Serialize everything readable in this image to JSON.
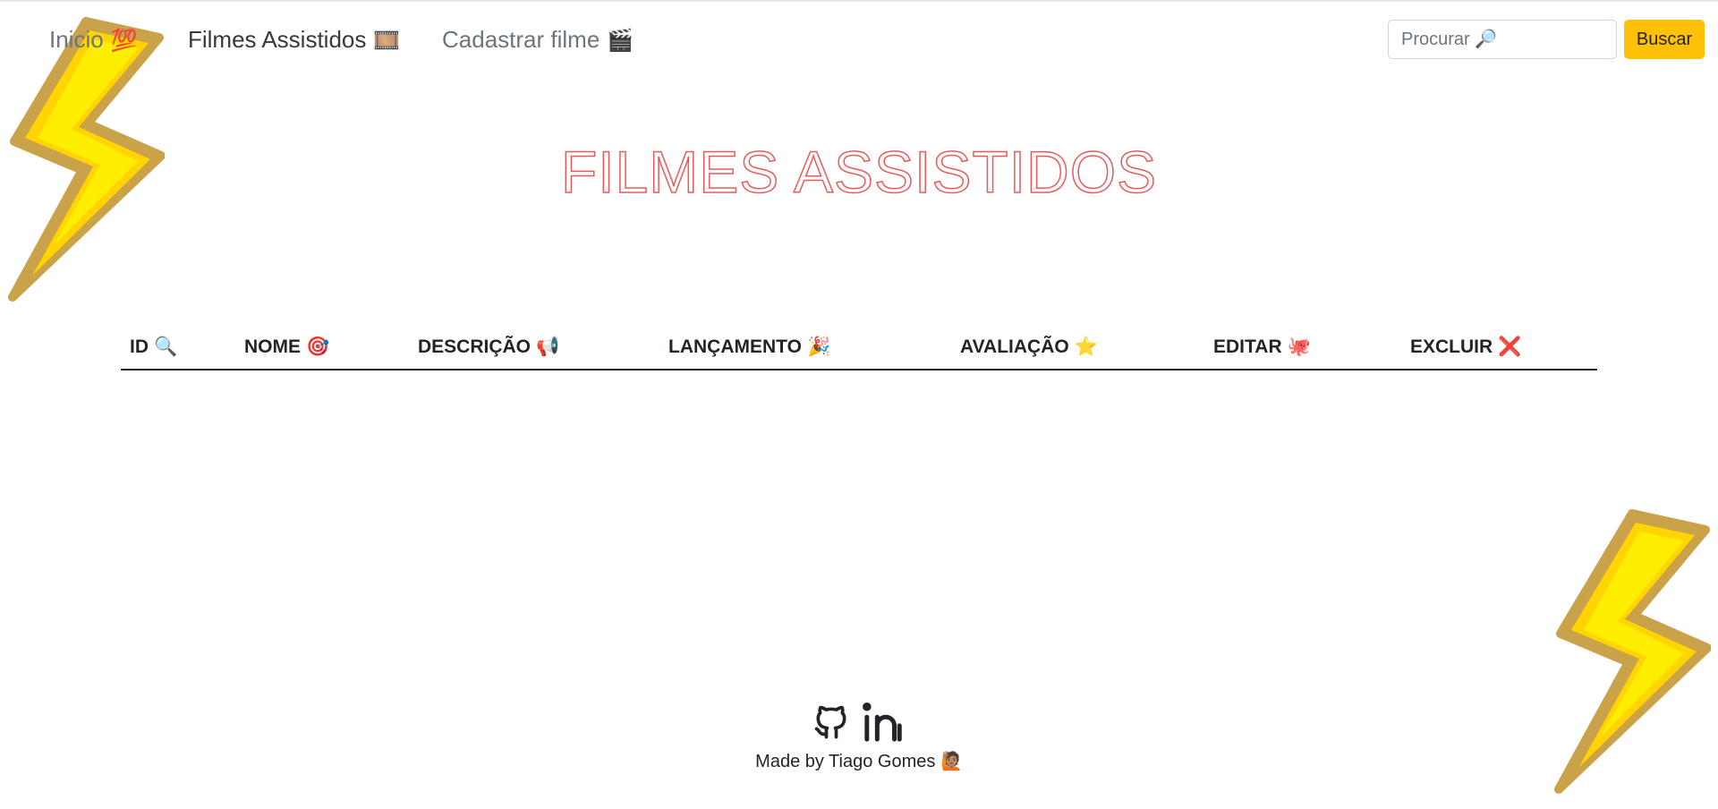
{
  "nav": {
    "items": [
      {
        "label": "Inicio",
        "emoji": "💯"
      },
      {
        "label": "Filmes Assistidos",
        "emoji": "🎞️"
      },
      {
        "label": "Cadastrar filme",
        "emoji": "🎬"
      }
    ],
    "search_placeholder": "Procurar 🔎",
    "search_button": "Buscar"
  },
  "page": {
    "title": "FILMES ASSISTIDOS"
  },
  "table": {
    "columns": [
      {
        "label": "ID",
        "emoji": "🔍"
      },
      {
        "label": "NOME",
        "emoji": "🎯"
      },
      {
        "label": "DESCRIÇÃO",
        "emoji": "📢"
      },
      {
        "label": "LANÇAMENTO",
        "emoji": "🎉"
      },
      {
        "label": "AVALIAÇÃO",
        "emoji": "⭐"
      },
      {
        "label": "EDITAR",
        "emoji": "🐙"
      },
      {
        "label": "EXCLUIR",
        "emoji": "❌"
      }
    ],
    "rows": []
  },
  "footer": {
    "credit": "Made by Tiago Gomes",
    "credit_emoji": "🙋🏽",
    "icons": [
      "github-icon",
      "linkedin-icon"
    ]
  },
  "decor": {
    "bolt_color": "#ffe600",
    "bolt_outline": "#c9a24a",
    "accent": "#ffc107",
    "title_stroke": "#e85a5a"
  }
}
